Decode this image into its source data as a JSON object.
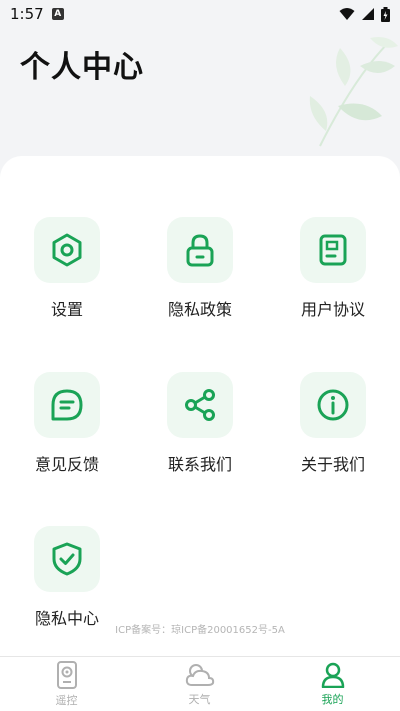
{
  "status_bar": {
    "time": "1:57",
    "notification_letter": "A"
  },
  "page": {
    "title": "个人中心"
  },
  "colors": {
    "accent": "#1aa356",
    "icon_bg": "#eef8f1",
    "tab_inactive": "#b0b0b0"
  },
  "menu": {
    "settings": {
      "label": "设置",
      "icon": "hexagon-nut-icon"
    },
    "privacy_policy": {
      "label": "隐私政策",
      "icon": "lock-icon"
    },
    "user_agreement": {
      "label": "用户协议",
      "icon": "document-icon"
    },
    "feedback": {
      "label": "意见反馈",
      "icon": "chat-bubble-icon"
    },
    "contact_us": {
      "label": "联系我们",
      "icon": "share-icon"
    },
    "about_us": {
      "label": "关于我们",
      "icon": "info-icon"
    },
    "privacy_center": {
      "label": "隐私中心",
      "icon": "shield-check-icon"
    }
  },
  "footer": {
    "icp": "ICP备案号：琼ICP备20001652号-5A"
  },
  "tabs": [
    {
      "label": "遥控",
      "icon": "remote-icon",
      "active": false
    },
    {
      "label": "天气",
      "icon": "weather-icon",
      "active": false
    },
    {
      "label": "我的",
      "icon": "person-icon",
      "active": true
    }
  ]
}
